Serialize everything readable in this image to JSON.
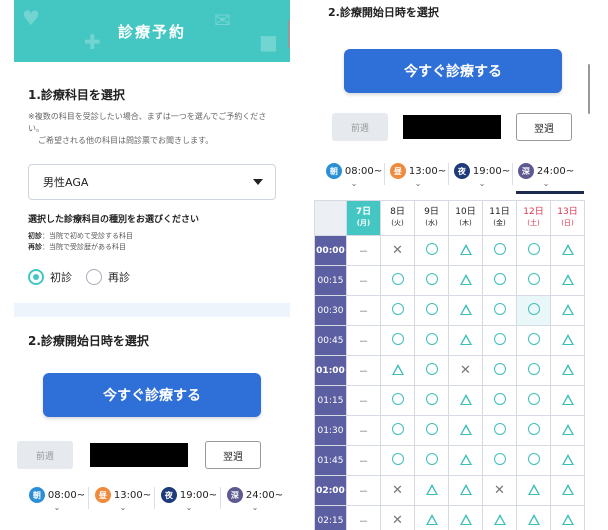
{
  "header": {
    "title": "診療予約"
  },
  "section1": {
    "title": "1.診療科目を選択",
    "note_line1": "※複数の科目を受診したい場合、まずは一つを選んでご予約ください。",
    "note_line2": "ご希望される他の科目は問診票でお聞きします。",
    "select_value": "男性AGA",
    "kind_title": "選択した診療科目の種別をお選びください",
    "kind_first_term": "初診",
    "kind_first_desc": "：当院で初めて受診する科目",
    "kind_re_term": "再診",
    "kind_re_desc": "：当院で受診歴がある科目",
    "radio_first": "初診",
    "radio_re": "再診"
  },
  "section2": {
    "title": "2.診療開始日時を選択",
    "now_button": "今すぐ診療する",
    "prev_week": "前週",
    "next_week": "翌週"
  },
  "time_tabs": [
    {
      "badge": "朝",
      "time": "08:00~",
      "color": "#2a8fd6"
    },
    {
      "badge": "昼",
      "time": "13:00~",
      "color": "#f08a3c"
    },
    {
      "badge": "夜",
      "time": "19:00~",
      "color": "#1e3a7a"
    },
    {
      "badge": "深",
      "time": "24:00~",
      "color": "#5c5a8f"
    }
  ],
  "calendar": {
    "days": [
      {
        "date": "7日",
        "dow": "(月)",
        "kind": "today"
      },
      {
        "date": "8日",
        "dow": "(火)",
        "kind": "normal"
      },
      {
        "date": "9日",
        "dow": "(水)",
        "kind": "normal"
      },
      {
        "date": "10日",
        "dow": "(木)",
        "kind": "normal"
      },
      {
        "date": "11日",
        "dow": "(金)",
        "kind": "normal"
      },
      {
        "date": "12日",
        "dow": "(土)",
        "kind": "sat"
      },
      {
        "date": "13日",
        "dow": "(日)",
        "kind": "sun"
      }
    ],
    "rows": [
      {
        "time": "00:00",
        "hour": true,
        "marks": [
          "dash",
          "cross",
          "circle",
          "tri",
          "circle",
          "circle",
          "tri"
        ]
      },
      {
        "time": "00:15",
        "hour": false,
        "marks": [
          "dash",
          "circle",
          "circle",
          "tri",
          "circle",
          "circle",
          "tri"
        ]
      },
      {
        "time": "00:30",
        "hour": false,
        "marks": [
          "dash",
          "circle",
          "circle",
          "tri",
          "circle",
          "circle",
          "tri"
        ]
      },
      {
        "time": "00:45",
        "hour": false,
        "marks": [
          "dash",
          "circle",
          "circle",
          "tri",
          "circle",
          "circle",
          "tri"
        ]
      },
      {
        "time": "01:00",
        "hour": true,
        "marks": [
          "dash",
          "tri",
          "circle",
          "cross",
          "circle",
          "circle",
          "tri"
        ]
      },
      {
        "time": "01:15",
        "hour": false,
        "marks": [
          "dash",
          "circle",
          "circle",
          "tri",
          "circle",
          "circle",
          "tri"
        ]
      },
      {
        "time": "01:30",
        "hour": false,
        "marks": [
          "dash",
          "circle",
          "circle",
          "tri",
          "circle",
          "circle",
          "tri"
        ]
      },
      {
        "time": "01:45",
        "hour": false,
        "marks": [
          "dash",
          "circle",
          "circle",
          "tri",
          "circle",
          "circle",
          "tri"
        ]
      },
      {
        "time": "02:00",
        "hour": true,
        "marks": [
          "dash",
          "cross",
          "tri",
          "tri",
          "cross",
          "tri",
          "tri"
        ]
      },
      {
        "time": "02:15",
        "hour": false,
        "marks": [
          "dash",
          "cross",
          "tri",
          "tri",
          "tri",
          "tri",
          "tri"
        ]
      }
    ],
    "symbols": {
      "dash": "－",
      "cross": "✕"
    }
  }
}
